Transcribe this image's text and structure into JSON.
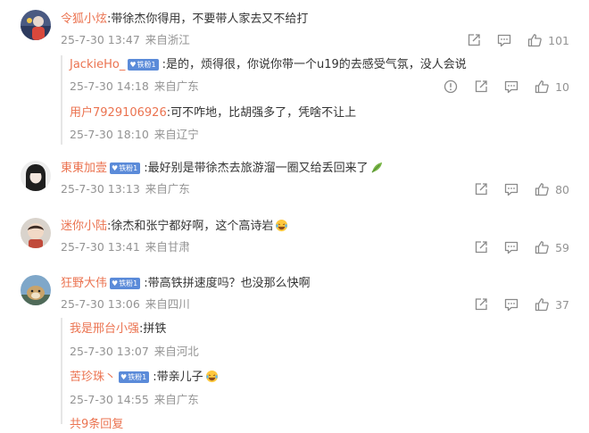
{
  "comments": [
    {
      "user": "令狐小炫",
      "text": "带徐杰你得用，不要带人家去又不给打",
      "date": "25-7-30 13:47",
      "location": "来自浙江",
      "likes": "101",
      "replies": [
        {
          "user": "JackieHo_",
          "badge": "铁粉1",
          "text": "是的，烦得很，你说你带一个u19的去感受气氛，没人会说",
          "date": "25-7-30 14:18",
          "location": "来自广东",
          "likes": "10"
        },
        {
          "user": "用户7929106926",
          "text": "可不咋地，比胡强多了，凭啥不让上",
          "date": "25-7-30 18:10",
          "location": "来自辽宁"
        }
      ]
    },
    {
      "user": "東東加壹",
      "badge": "铁粉1",
      "text": "最好别是带徐杰去旅游溜一圈又给丢回来了",
      "date": "25-7-30 13:13",
      "location": "来自广东",
      "likes": "80"
    },
    {
      "user": "迷你小陆",
      "text": "徐杰和张宁都好啊，这个高诗岩",
      "date": "25-7-30 13:41",
      "location": "来自甘肃",
      "likes": "59"
    },
    {
      "user": "狂野大伟",
      "badge": "铁粉1",
      "text": "带高铁拼速度吗？也没那么快啊",
      "date": "25-7-30 13:06",
      "location": "来自四川",
      "likes": "37",
      "replies": [
        {
          "user": "我是邢台小强",
          "text": "拼铁",
          "date": "25-7-30 13:07",
          "location": "来自河北"
        },
        {
          "user": "苦珍珠丶",
          "badge": "铁粉1",
          "text": "带亲儿子",
          "date": "25-7-30 14:55",
          "location": "来自广东"
        }
      ]
    }
  ],
  "more_replies_label": "共9条回复",
  "colors": {
    "username": "#eb7350",
    "meta": "#939393",
    "badge": "#5b8bd9"
  },
  "icons": [
    "share-icon",
    "comment-icon",
    "like-icon",
    "report-icon",
    "leaf-emoji",
    "laugh-cry-emoji"
  ]
}
